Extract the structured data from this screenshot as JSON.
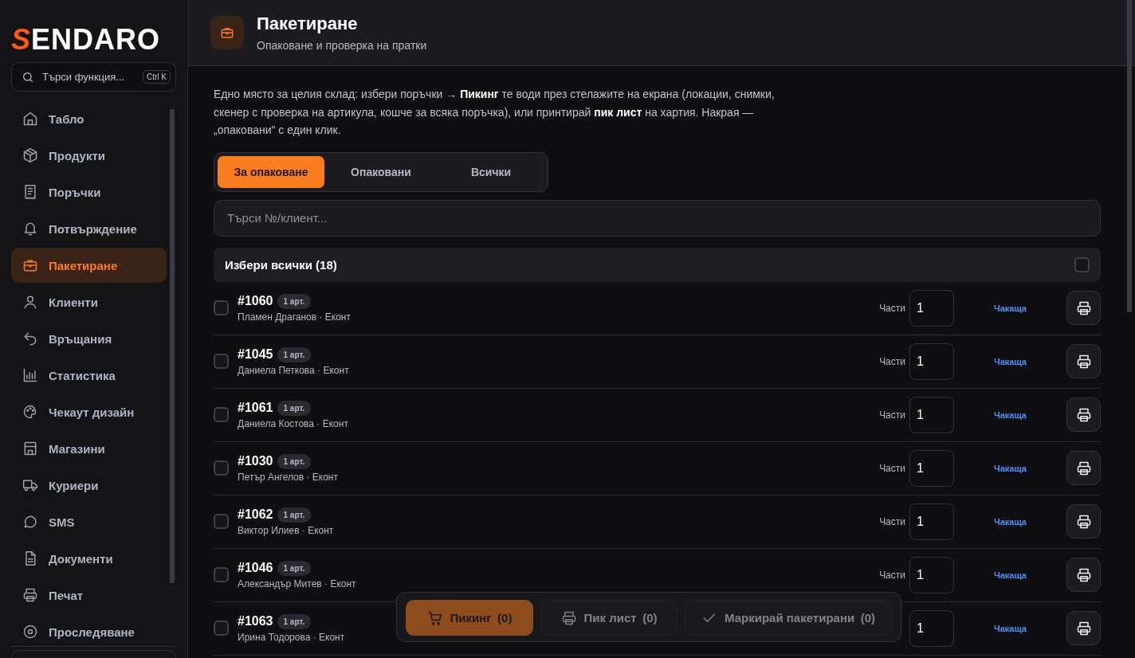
{
  "sidebar": {
    "logo": "SENDARO",
    "search": {
      "placeholder": "Търси функция...",
      "shortcut": "Ctrl K"
    },
    "items": [
      {
        "label": "Табло",
        "selected": false
      },
      {
        "label": "Продукти",
        "selected": false
      },
      {
        "label": "Поръчки",
        "selected": false
      },
      {
        "label": "Потвърждение",
        "selected": false
      },
      {
        "label": "Пакетиране",
        "selected": true
      },
      {
        "label": "Клиенти",
        "selected": false
      },
      {
        "label": "Връщания",
        "selected": false
      },
      {
        "label": "Статистика",
        "selected": false
      },
      {
        "label": "Чекаут дизайн",
        "selected": false
      },
      {
        "label": "Магазини",
        "selected": false
      },
      {
        "label": "Куриери",
        "selected": false
      },
      {
        "label": "SMS",
        "selected": false
      },
      {
        "label": "Документи",
        "selected": false
      },
      {
        "label": "Печат",
        "selected": false
      },
      {
        "label": "Проследяване",
        "selected": false
      }
    ]
  },
  "header": {
    "title": "Пакетиране",
    "subtitle": "Опаковане и проверка на пратки"
  },
  "intro": "Едно място за целия склад: избери поръчки → **Пикинг** те води през стелажите на екрана (локации, снимки, скенер с проверка на артикула, кошче за всяка поръчка), или принтирай **пик лист** на хартия. Накрая — „опаковани\" с един клик.",
  "tabs": [
    {
      "label": "За опаковане",
      "selected": true
    },
    {
      "label": "Опаковани",
      "selected": false
    },
    {
      "label": "Всички",
      "selected": false
    }
  ],
  "search": {
    "placeholder": "Търси №/клиент..."
  },
  "select_all": {
    "label": "Избери всички (18)",
    "checked": false
  },
  "orders": [
    {
      "number": "#1060",
      "badge": "1 арт.",
      "customer": "Пламен Драганов · Еконт",
      "checked": false,
      "parts_label": "Части",
      "parts": "1",
      "status": "Чакаща"
    },
    {
      "number": "#1045",
      "badge": "1 арт.",
      "customer": "Даниела Петкова · Еконт",
      "checked": false,
      "parts_label": "Части",
      "parts": "1",
      "status": "Чакаща"
    },
    {
      "number": "#1061",
      "badge": "1 арт.",
      "customer": "Даниела Костова · Еконт",
      "checked": false,
      "parts_label": "Части",
      "parts": "1",
      "status": "Чакаща"
    },
    {
      "number": "#1030",
      "badge": "1 арт.",
      "customer": "Петър Ангелов · Еконт",
      "checked": false,
      "parts_label": "Части",
      "parts": "1",
      "status": "Чакаща"
    },
    {
      "number": "#1062",
      "badge": "1 арт.",
      "customer": "Виктор Илиев · Еконт",
      "checked": false,
      "parts_label": "Части",
      "parts": "1",
      "status": "Чакаща"
    },
    {
      "number": "#1046",
      "badge": "1 арт.",
      "customer": "Александър Митев · Еконт",
      "checked": false,
      "parts_label": "Части",
      "parts": "1",
      "status": "Чакаща"
    },
    {
      "number": "#1063",
      "badge": "1 арт.",
      "customer": "Ирина Тодорова · Еконт",
      "checked": false,
      "parts": "1",
      "status": "Чакаща"
    }
  ],
  "action_bar": [
    {
      "kind": "picking",
      "label": "Пикинг",
      "count": "(0)",
      "disabled": true
    },
    {
      "kind": "picklist",
      "label": "Пик лист",
      "count": "(0)",
      "disabled": true
    },
    {
      "kind": "mark",
      "label": "Маркирай пакетирани",
      "count": "(0)",
      "disabled": true
    }
  ]
}
